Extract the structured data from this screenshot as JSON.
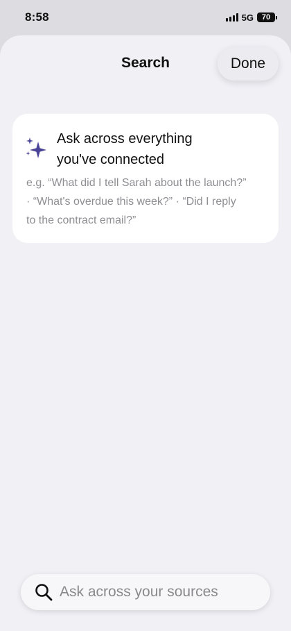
{
  "status_bar": {
    "time": "8:58",
    "network": "5G",
    "battery": "70"
  },
  "header": {
    "title": "Search",
    "done_label": "Done"
  },
  "info_card": {
    "icon": "sparkle-icon",
    "title_line1": "Ask across everything",
    "title_line2": "you've connected",
    "examples_line1": "e.g. “What did I tell Sarah about the launch?”",
    "examples_line2": "· “What's overdue this week?” · “Did I reply",
    "examples_line3": "to the contract email?”"
  },
  "search": {
    "placeholder": "Ask across your sources",
    "value": ""
  },
  "colors": {
    "accent": "#4a4397",
    "sheet_bg": "#f0f0f5",
    "card_bg": "#ffffff",
    "secondary_text": "#8e8e93"
  }
}
